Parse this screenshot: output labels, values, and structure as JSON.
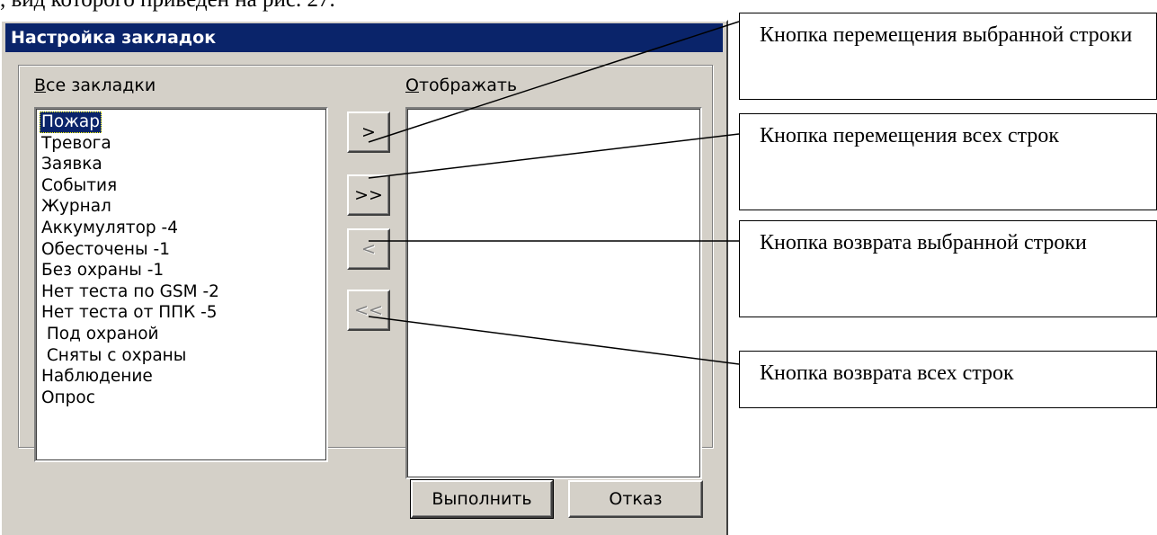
{
  "caption_fragment": ", вид которого приведен на рис. 27.",
  "dialog": {
    "title": "Настройка закладок",
    "all_label_accel": "В",
    "all_label_rest": "се закладки",
    "show_label_accel": "О",
    "show_label_rest": "тображать",
    "all_items": [
      "Пожар",
      "Тревога",
      "Заявка",
      "События",
      "Журнал",
      "Аккумулятор -4",
      "Обесточены -1",
      "Без охраны -1",
      "Нет теста по GSM -2",
      "Нет теста от ППК -5",
      " Под охраной",
      " Сняты с охраны",
      "Наблюдение",
      "Опрос"
    ],
    "selected_item": "Пожар",
    "shown_items": [],
    "buttons": {
      "move_one": ">",
      "move_all": ">>",
      "return_one": "<",
      "return_all": "<<",
      "ok": "Выполнить",
      "cancel": "Отказ"
    }
  },
  "callouts": {
    "move_one": "Кнопка перемещения выбранной строки",
    "move_all": "Кнопка перемещения всех строк",
    "return_one": "Кнопка возврата выбранной строки",
    "return_all": "Кнопка возврата всех строк"
  }
}
